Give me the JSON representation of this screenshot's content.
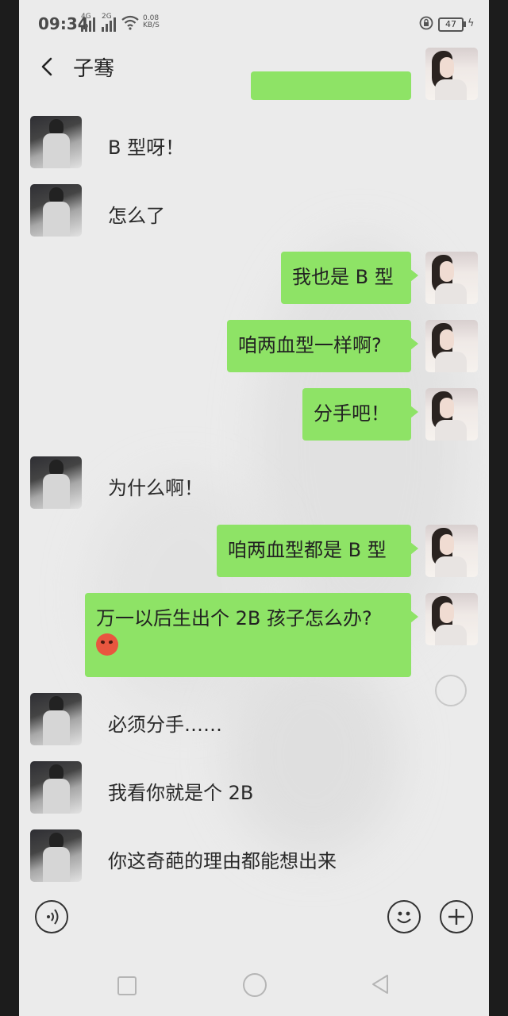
{
  "status_bar": {
    "time": "09:34",
    "network1": "4G",
    "network2": "2G",
    "speed_value": "0.08",
    "speed_unit": "KB/S",
    "battery": "47"
  },
  "header": {
    "title": "子骞"
  },
  "messages": [
    {
      "side": "left",
      "text": "B 型呀！"
    },
    {
      "side": "left",
      "text": "怎么了"
    },
    {
      "side": "right",
      "text": "我也是 B 型"
    },
    {
      "side": "right",
      "text": "咱两血型一样啊?"
    },
    {
      "side": "right",
      "text": "分手吧！"
    },
    {
      "side": "left",
      "text": "为什么啊！"
    },
    {
      "side": "right",
      "text": "咱两血型都是 B 型"
    },
    {
      "side": "right",
      "text": "万一以后生出个 2B 孩子怎么办?",
      "emoji": "angry-face"
    },
    {
      "side": "left",
      "text": "必须分手……"
    },
    {
      "side": "left",
      "text": "我看你就是个 2B"
    },
    {
      "side": "left",
      "text": "你这奇葩的理由都能想出来"
    }
  ],
  "icons": {
    "back": "back-chevron",
    "more": "more-dots",
    "voice": "voice-icon",
    "emoji": "smiley-icon",
    "plus": "plus-icon"
  },
  "colors": {
    "bubble_green": "#8ee366",
    "background": "#ebebeb"
  }
}
